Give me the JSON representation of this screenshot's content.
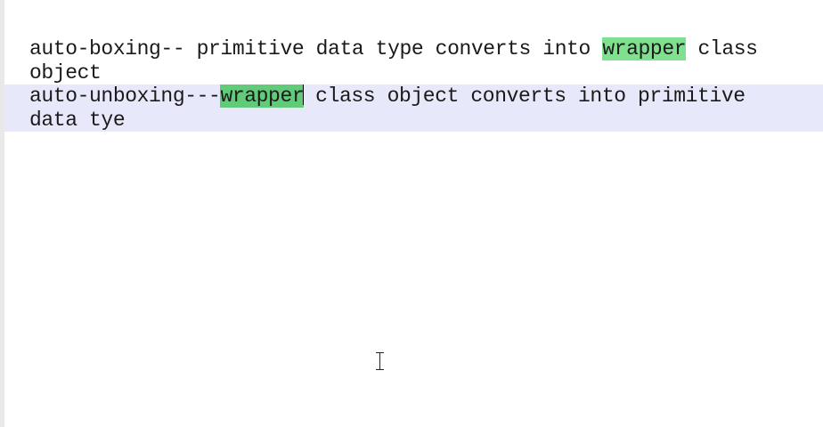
{
  "editor": {
    "line1": {
      "before": "auto-boxing-- primitive data type converts into ",
      "match": "wrapper",
      "after": " class object"
    },
    "line2": {
      "before": "auto-unboxing---",
      "match": "wrapper",
      "after": " class object converts into primitive data tye"
    }
  },
  "highlight_colors": {
    "match": "#7fe08f",
    "active_match": "#62cb79",
    "current_line": "#e8e8fb"
  },
  "cursor": {
    "icon": "i-beam-cursor-icon"
  }
}
